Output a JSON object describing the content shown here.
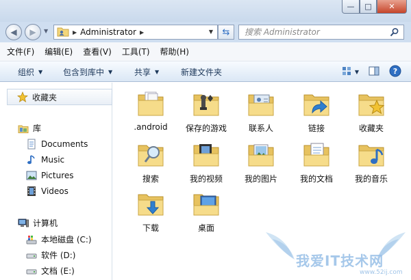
{
  "window": {
    "controls": {
      "min": "—",
      "max": "□",
      "close": "✕"
    }
  },
  "address": {
    "path": "Administrator",
    "search_placeholder": "搜索 Administrator"
  },
  "menu": [
    "文件(F)",
    "编辑(E)",
    "查看(V)",
    "工具(T)",
    "帮助(H)"
  ],
  "toolbar": {
    "organize": "组织",
    "include_library": "包含到库中",
    "share": "共享",
    "new_folder": "新建文件夹"
  },
  "sidebar": {
    "favorites": "收藏夹",
    "libraries": "库",
    "library_items": [
      "Documents",
      "Music",
      "Pictures",
      "Videos"
    ],
    "computer": "计算机",
    "drives": [
      "本地磁盘 (C:)",
      "软件 (D:)",
      "文档 (E:)"
    ]
  },
  "files": [
    {
      "name": ".android",
      "icon": "folder-documents-icon"
    },
    {
      "name": "保存的游戏",
      "icon": "folder-games-icon"
    },
    {
      "name": "联系人",
      "icon": "folder-contacts-icon"
    },
    {
      "name": "链接",
      "icon": "folder-links-icon"
    },
    {
      "name": "收藏夹",
      "icon": "folder-favorites-icon"
    },
    {
      "name": "搜索",
      "icon": "folder-search-icon"
    },
    {
      "name": "我的视频",
      "icon": "folder-videos-icon"
    },
    {
      "name": "我的图片",
      "icon": "folder-pictures-icon"
    },
    {
      "name": "我的文档",
      "icon": "folder-documents-icon"
    },
    {
      "name": "我的音乐",
      "icon": "folder-music-icon"
    },
    {
      "name": "下载",
      "icon": "folder-downloads-icon"
    },
    {
      "name": "桌面",
      "icon": "folder-desktop-icon"
    }
  ],
  "watermark": {
    "text": "我爱IT技术网",
    "url": "www.52ij.com"
  },
  "colors": {
    "folder": "#f3d67a",
    "accent": "#2f6fc3",
    "command_text": "#1e395b"
  }
}
